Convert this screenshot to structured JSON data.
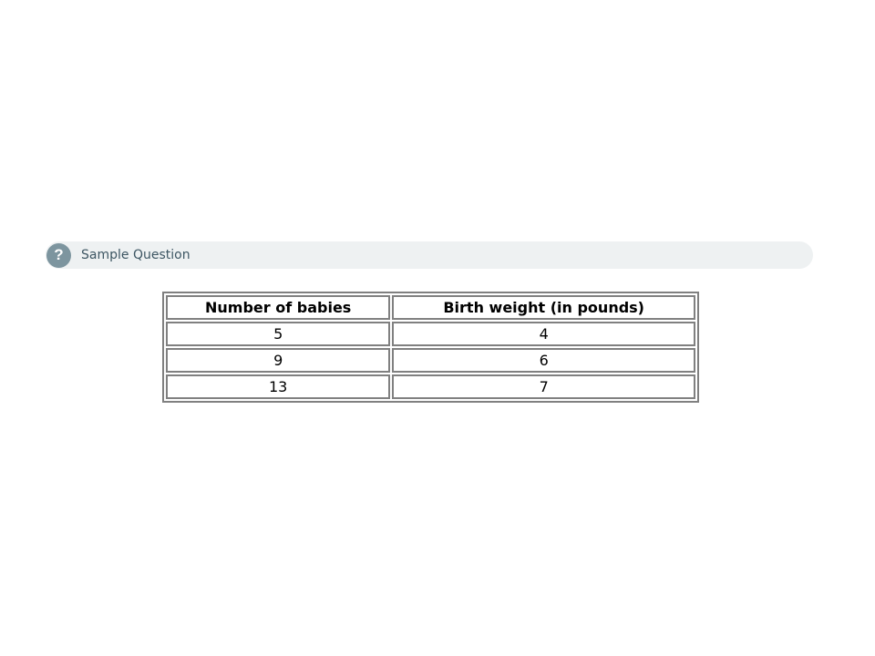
{
  "question": {
    "icon": "help-icon",
    "label": "Sample Question"
  },
  "table": {
    "headers": [
      "Number of babies",
      "Birth weight (in pounds)"
    ],
    "rows": [
      [
        "5",
        "4"
      ],
      [
        "9",
        "6"
      ],
      [
        "13",
        "7"
      ]
    ]
  },
  "colors": {
    "bar_background": "#eef1f2",
    "icon_background": "#7d959f",
    "label_text": "#3d5663",
    "table_border": "#808080"
  }
}
